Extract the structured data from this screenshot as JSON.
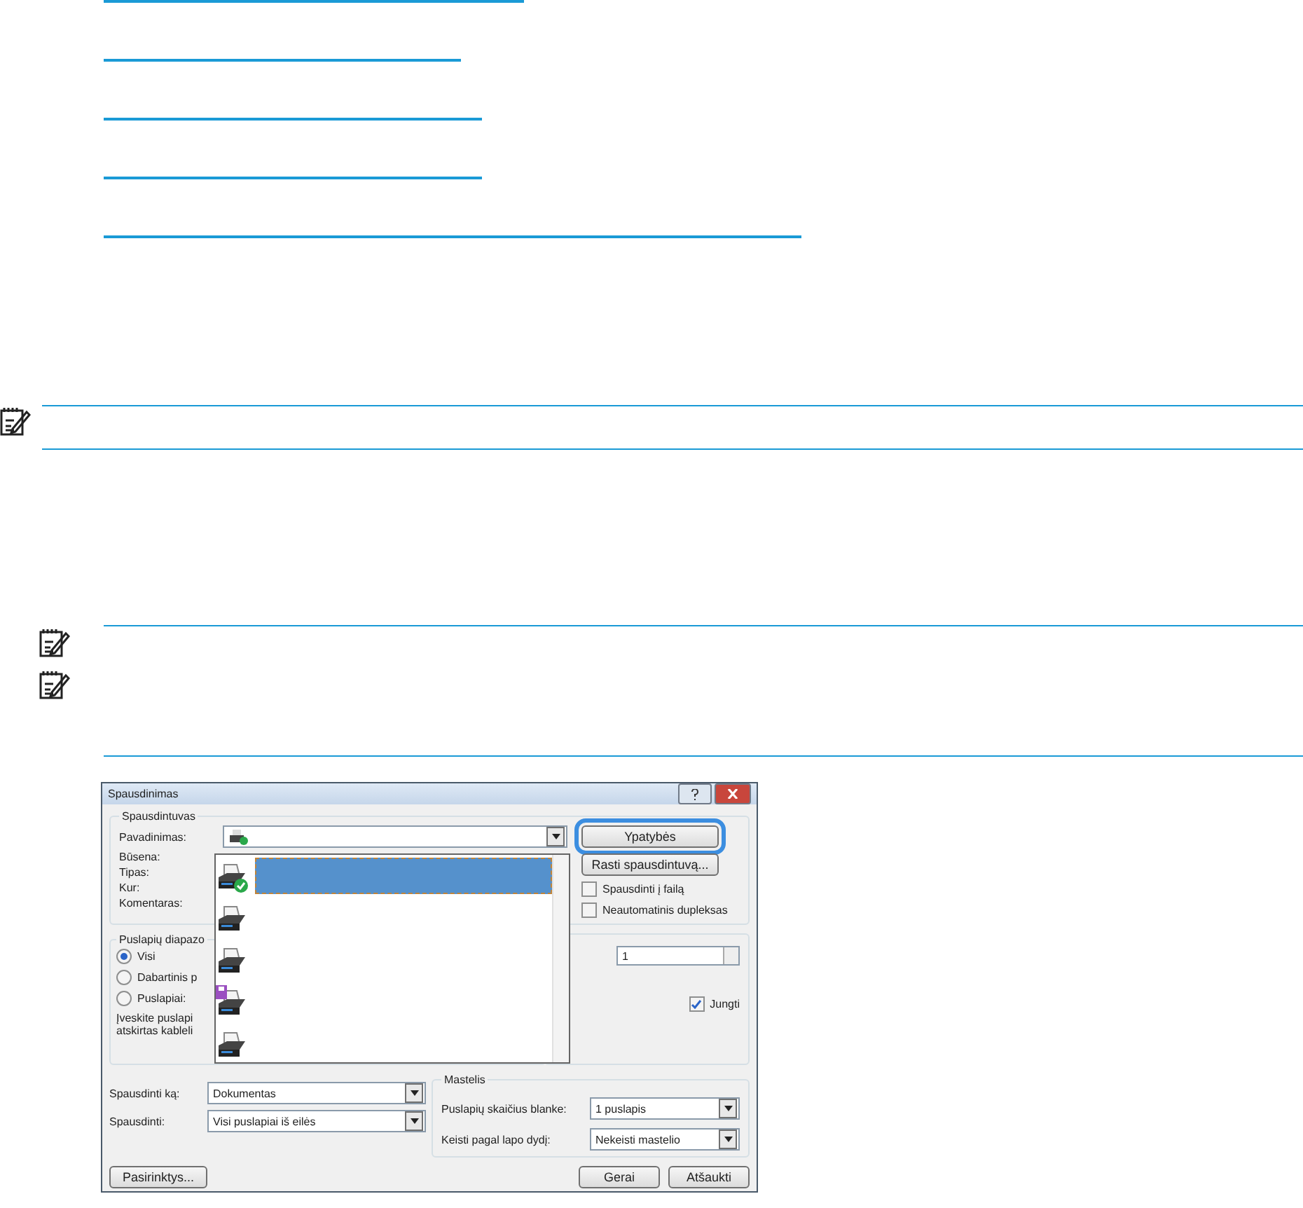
{
  "dialog": {
    "title": "Spausdinimas",
    "printer_group": {
      "title": "Spausdintuvas",
      "labels": [
        "Pavadinimas:",
        "Būsena:",
        "Tipas:",
        "Kur:",
        "Komentaras:"
      ],
      "buttons": [
        {
          "label": "Ypatybės",
          "focused": true
        },
        {
          "label": "Rasti spausdintuvą...",
          "focused": false
        }
      ],
      "checkboxes": [
        {
          "label": "Spausdinti į failą",
          "checked": false
        },
        {
          "label": "Neautomatinis dupleksas",
          "checked": false
        }
      ]
    },
    "printer_list": {
      "items": [
        {
          "kind": "default",
          "selected": true
        },
        {
          "kind": "printer",
          "selected": false
        },
        {
          "kind": "printer",
          "selected": false
        },
        {
          "kind": "fax",
          "selected": false
        },
        {
          "kind": "printer",
          "selected": false
        }
      ]
    },
    "range_group": {
      "title": "Puslapių diapazo",
      "options": [
        {
          "label": "Visi",
          "selected": true
        },
        {
          "label": "Dabartinis p",
          "selected": false
        },
        {
          "label": "Puslapiai:",
          "selected": false
        }
      ],
      "hint_lines": [
        "Įveskite puslapi",
        "atskirtas kableli"
      ]
    },
    "copies": {
      "value": "1",
      "collate": {
        "label": "Jungti",
        "checked": true
      }
    },
    "print_what": [
      {
        "label": "Spausdinti ką:",
        "value": "Dokumentas"
      },
      {
        "label": "Spausdinti:",
        "value": "Visi puslapiai iš eilės"
      }
    ],
    "zoom_group": {
      "title": "Mastelis",
      "rows": [
        {
          "label": "Puslapių skaičius blanke:",
          "value": "1 puslapis"
        },
        {
          "label": "Keisti pagal lapo dydį:",
          "value": "Nekeisti mastelio"
        }
      ]
    },
    "options_button": "Pasirinktys...",
    "buttons": [
      "Gerai",
      "Atšaukti"
    ]
  }
}
